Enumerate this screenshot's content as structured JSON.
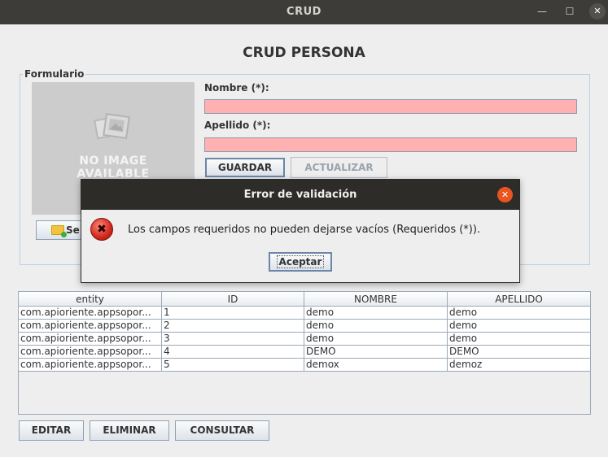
{
  "window": {
    "title": "CRUD",
    "minimize_icon": "minimize-icon",
    "maximize_icon": "maximize-icon",
    "close_icon": "close-icon"
  },
  "header": {
    "title": "CRUD PERSONA"
  },
  "form": {
    "group_title": "Formulario",
    "photo": {
      "placeholder_line1": "NO IMAGE",
      "placeholder_line2": "AVAILABLE",
      "icon": "image-placeholder-icon"
    },
    "select_button": {
      "label": "Se",
      "icon": "folder-add-icon"
    },
    "nombre_label": "Nombre (*):",
    "nombre_value": "",
    "apellido_label": "Apellido (*):",
    "apellido_value": "",
    "guardar_label": "GUARDAR",
    "actualizar_label": "ACTUALIZAR",
    "invalid_field_color": "#ffb0b0"
  },
  "table": {
    "columns": [
      "entity",
      "ID",
      "NOMBRE",
      "APELLIDO"
    ],
    "rows": [
      [
        "com.apioriente.appsopor...",
        "1",
        "demo",
        "demo"
      ],
      [
        "com.apioriente.appsopor...",
        "2",
        "demo",
        "demo"
      ],
      [
        "com.apioriente.appsopor...",
        "3",
        "demo",
        "demo"
      ],
      [
        "com.apioriente.appsopor...",
        "4",
        "DEMO",
        "DEMO"
      ],
      [
        "com.apioriente.appsopor...",
        "5",
        "demox",
        "demoz"
      ]
    ]
  },
  "actions": {
    "editar_label": "EDITAR",
    "eliminar_label": "ELIMINAR",
    "consultar_label": "CONSULTAR"
  },
  "dialog": {
    "title": "Error de validación",
    "close_icon": "close-icon",
    "icon": "error-icon",
    "message": "Los campos requeridos no pueden dejarse vacíos (Requeridos (*)).",
    "accept_label": "Aceptar",
    "close_color": "#e9541f"
  }
}
